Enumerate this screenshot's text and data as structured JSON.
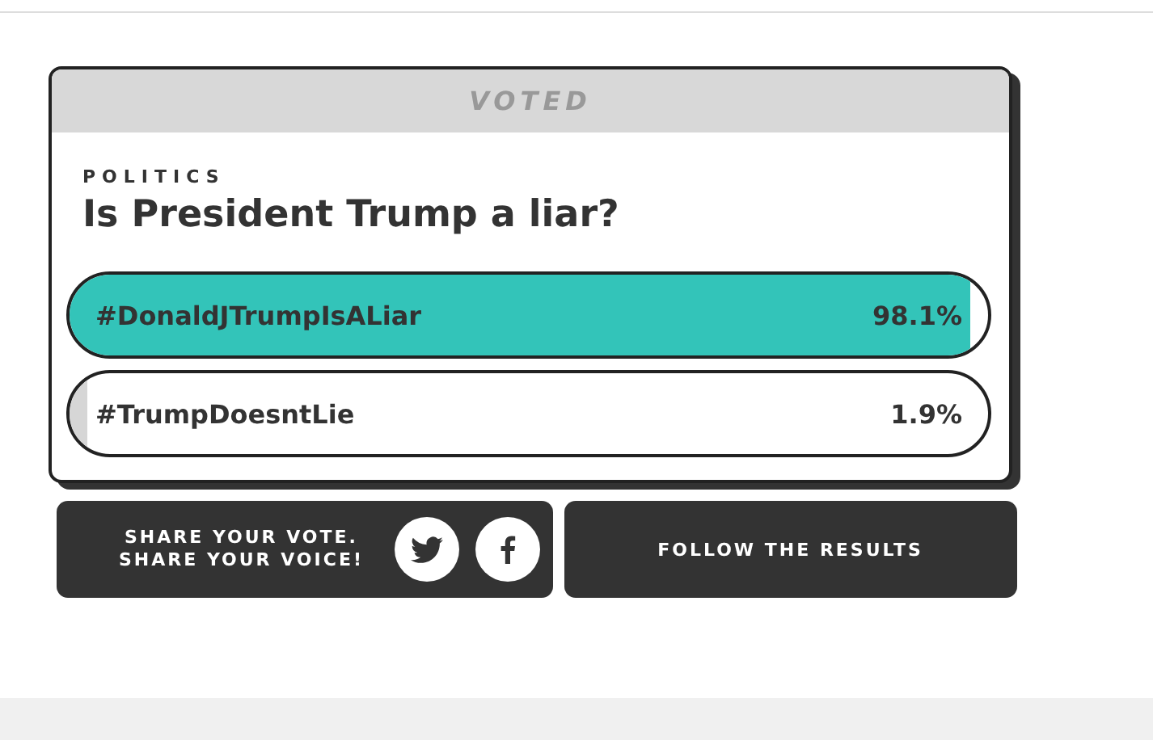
{
  "poll": {
    "status": "VOTED",
    "category": "POLITICS",
    "question": "Is President Trump a liar?",
    "options": [
      {
        "label": "#DonaldJTrumpIsALiar",
        "reading": "98.1%",
        "level": 0.981,
        "selected": true
      },
      {
        "label": "#TrumpDoesntLie",
        "reading": "1.9%",
        "level": 0.019,
        "selected": false
      }
    ]
  },
  "share": {
    "text_lines": [
      "SHARE YOUR VOTE.",
      "SHARE YOUR VOICE!"
    ]
  },
  "follow_button": "FOLLOW THE RESULTS"
}
